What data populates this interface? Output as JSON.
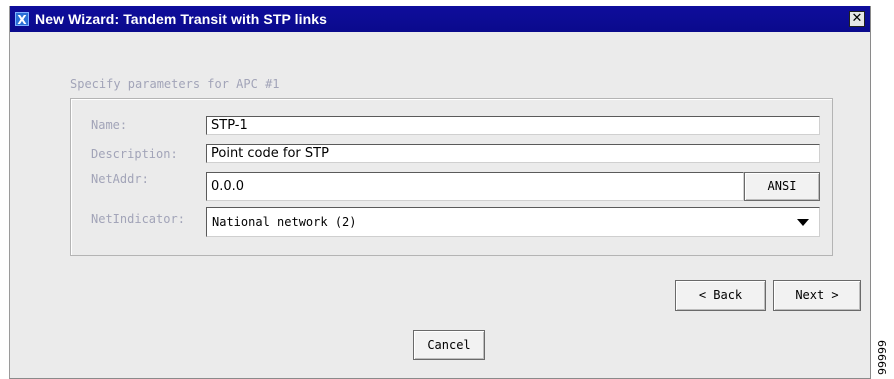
{
  "window": {
    "title": "New Wizard: Tandem Transit with STP links",
    "logo_letter": "X",
    "close_glyph": "✕",
    "icons": {
      "logo": "x-logo-icon",
      "close": "close-icon"
    }
  },
  "form": {
    "section_label": "Specify parameters for APC #1",
    "fields": {
      "name": {
        "label": "Name:",
        "value": "STP-1"
      },
      "description": {
        "label": "Description:",
        "value": "Point code for STP"
      },
      "netaddr": {
        "label": "NetAddr:",
        "value": "0.0.0",
        "format_button": "ANSI"
      },
      "netindicator": {
        "label": "NetIndicator:",
        "selected": "National network (2)"
      }
    }
  },
  "buttons": {
    "back": "< Back",
    "next": "Next >",
    "cancel": "Cancel"
  },
  "side_mark": "99999",
  "colors": {
    "titlebar": "#0f0d9c",
    "window_bg": "#ebebeb",
    "label": "#a2a4b8"
  }
}
